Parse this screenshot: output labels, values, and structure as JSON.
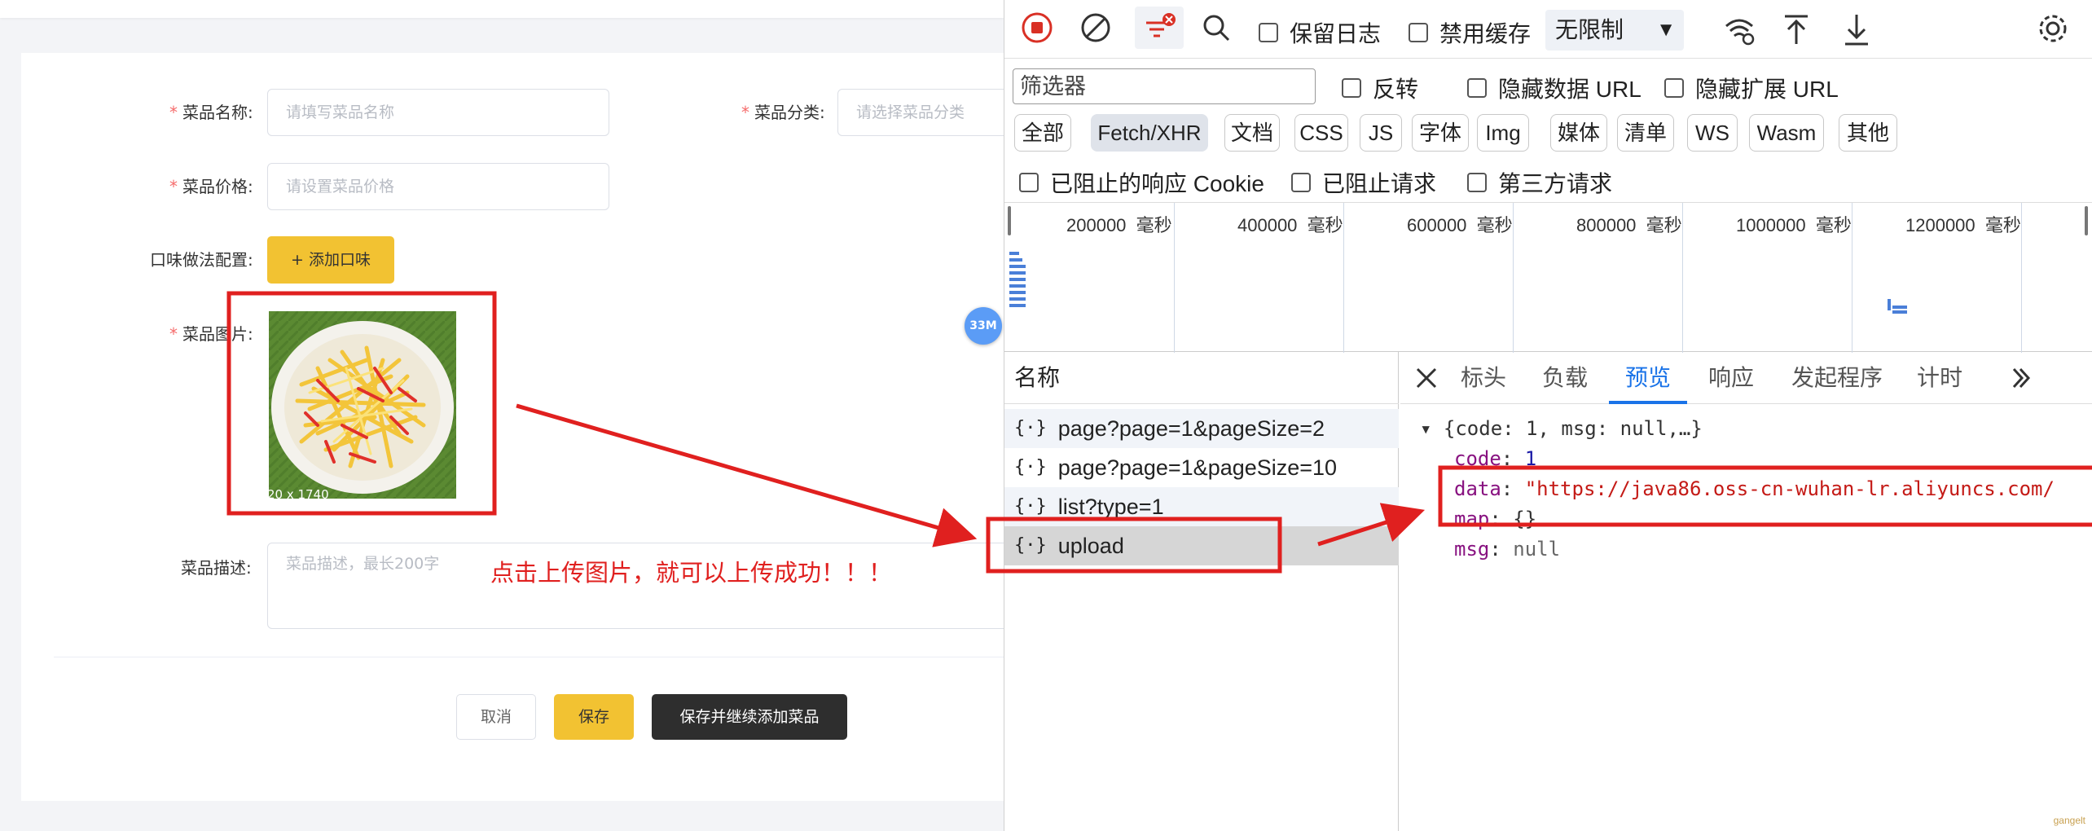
{
  "form": {
    "name_label": "菜品名称:",
    "name_placeholder": "请填写菜品名称",
    "category_label": "菜品分类:",
    "category_placeholder": "请选择菜品分类",
    "price_label": "菜品价格:",
    "price_placeholder": "请设置菜品价格",
    "flavor_label": "口味做法配置:",
    "add_flavor_button": "+ 添加口味",
    "image_label": "菜品图片:",
    "image_caption": "20 x 1740",
    "desc_label": "菜品描述:",
    "desc_placeholder": "菜品描述，最长200字",
    "cancel_button": "取消",
    "save_button": "保存",
    "save_continue_button": "保存并继续添加菜品",
    "required_mark": "*"
  },
  "annotation": {
    "text": "点击上传图片，就可以上传成功！！！",
    "color": "#e0201f"
  },
  "floating_badge": "33M",
  "devtools": {
    "toolbar": {
      "preserve_log": "保留日志",
      "disable_cache": "禁用缓存",
      "throttling": "无限制"
    },
    "filter_placeholder": "筛选器",
    "invert": "反转",
    "hide_data_urls": "隐藏数据 URL",
    "hide_ext_urls": "隐藏扩展 URL",
    "type_filters": [
      "全部",
      "Fetch/XHR",
      "文档",
      "CSS",
      "JS",
      "字体",
      "Img",
      "媒体",
      "清单",
      "WS",
      "Wasm",
      "其他"
    ],
    "active_filter": "Fetch/XHR",
    "blocked_cookies": "已阻止的响应 Cookie",
    "blocked_requests": "已阻止请求",
    "third_party": "第三方请求",
    "timeline_ticks": [
      {
        "value": "200000",
        "unit": "毫秒"
      },
      {
        "value": "400000",
        "unit": "毫秒"
      },
      {
        "value": "600000",
        "unit": "毫秒"
      },
      {
        "value": "800000",
        "unit": "毫秒"
      },
      {
        "value": "1000000",
        "unit": "毫秒"
      },
      {
        "value": "1200000",
        "unit": "毫秒"
      }
    ],
    "name_header": "名称",
    "requests": [
      {
        "name": "page?page=1&pageSize=2"
      },
      {
        "name": "page?page=1&pageSize=10"
      },
      {
        "name": "list?type=1"
      },
      {
        "name": "upload"
      }
    ],
    "selected_request": "upload",
    "detail_tabs": [
      "标头",
      "负载",
      "预览",
      "响应",
      "发起程序",
      "计时"
    ],
    "active_tab": "预览",
    "preview": {
      "summary": "{code: 1, msg: null,…}",
      "code_key": "code",
      "code_val": "1",
      "data_key": "data",
      "data_val": "\"https://java86.oss-cn-wuhan-lr.aliyuncs.com/",
      "map_key": "map",
      "map_val": "{}",
      "msg_key": "msg",
      "msg_val": "null"
    },
    "accent_color": "#1a73e8",
    "record_color": "#d93025"
  },
  "watermark": "gangelt"
}
